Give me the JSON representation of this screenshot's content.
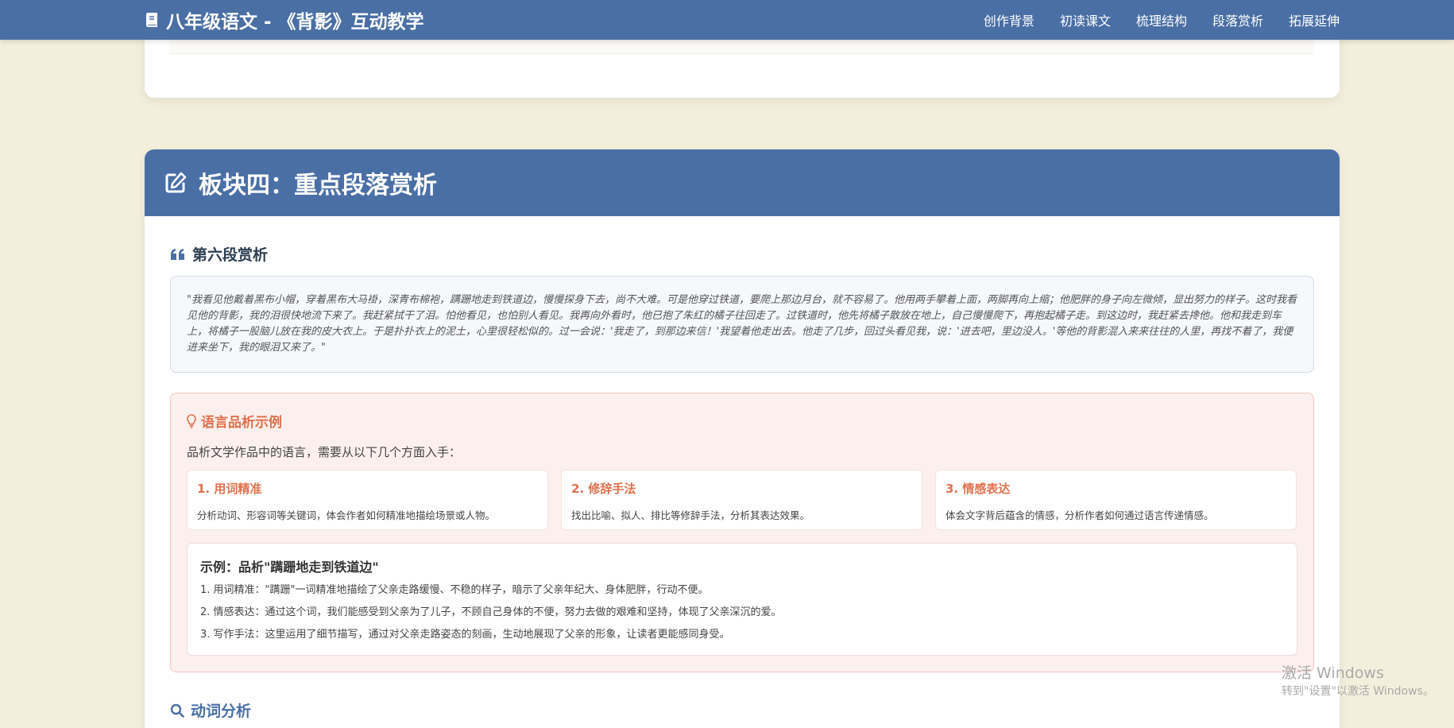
{
  "navbar": {
    "title": "八年级语文 - 《背影》互动教学",
    "links": [
      "创作背景",
      "初读课文",
      "梳理结构",
      "段落赏析",
      "拓展延伸"
    ]
  },
  "section": {
    "title": "板块四：重点段落赏析",
    "paragraph_heading": "第六段赏析",
    "quote": "\"我看见他戴着黑布小帽，穿着黑布大马褂，深青布棉袍，蹒跚地走到铁道边，慢慢探身下去，尚不大难。可是他穿过铁道，要爬上那边月台，就不容易了。他用两手攀着上面，两脚再向上缩；他肥胖的身子向左微倾，显出努力的样子。这时我看见他的背影，我的泪很快地流下来了。我赶紧拭干了泪。怕他看见，也怕别人看见。我再向外看时，他已抱了朱红的橘子往回走了。过铁道时，他先将橘子散放在地上，自己慢慢爬下，再抱起橘子走。到这边时，我赶紧去搀他。他和我走到车上，将橘子一股脑儿放在我的皮大衣上。于是扑扑衣上的泥土，心里很轻松似的。过一会说：'我走了，到那边来信！'我望着他走出去。他走了几步，回过头看见我，说：'进去吧，里边没人。'等他的背影混入来来往往的人里，再找不着了，我便进来坐下，我的眼泪又来了。\"",
    "analysis": {
      "title": "语言品析示例",
      "intro": "品析文学作品中的语言，需要从以下几个方面入手：",
      "methods": [
        {
          "title": "1. 用词精准",
          "desc": "分析动词、形容词等关键词，体会作者如何精准地描绘场景或人物。"
        },
        {
          "title": "2. 修辞手法",
          "desc": "找出比喻、拟人、排比等修辞手法，分析其表达效果。"
        },
        {
          "title": "3. 情感表达",
          "desc": "体会文字背后蕴含的情感，分析作者如何通过语言传递情感。"
        }
      ],
      "example": {
        "title": "示例：品析\"蹒跚地走到铁道边\"",
        "lines": [
          "1. 用词精准：\"蹒跚\"一词精准地描绘了父亲走路缓慢、不稳的样子，暗示了父亲年纪大、身体肥胖，行动不便。",
          "2. 情感表达：通过这个词，我们能感受到父亲为了儿子，不顾自己身体的不便，努力去做的艰难和坚持，体现了父亲深沉的爱。",
          "3. 写作手法：这里运用了细节描写，通过对父亲走路姿态的刻画，生动地展现了父亲的形象，让读者更能感同身受。"
        ]
      }
    },
    "verb_heading": "动词分析"
  },
  "watermark": {
    "line1": "激活 Windows",
    "line2": "转到\"设置\"以激活 Windows。"
  },
  "colors": {
    "primary": "#4a6fa5",
    "accent": "#e0714e",
    "background": "#f4efdc"
  },
  "icons": [
    "book-icon",
    "edit-icon",
    "quote-icon",
    "lightbulb-icon",
    "search-icon"
  ]
}
